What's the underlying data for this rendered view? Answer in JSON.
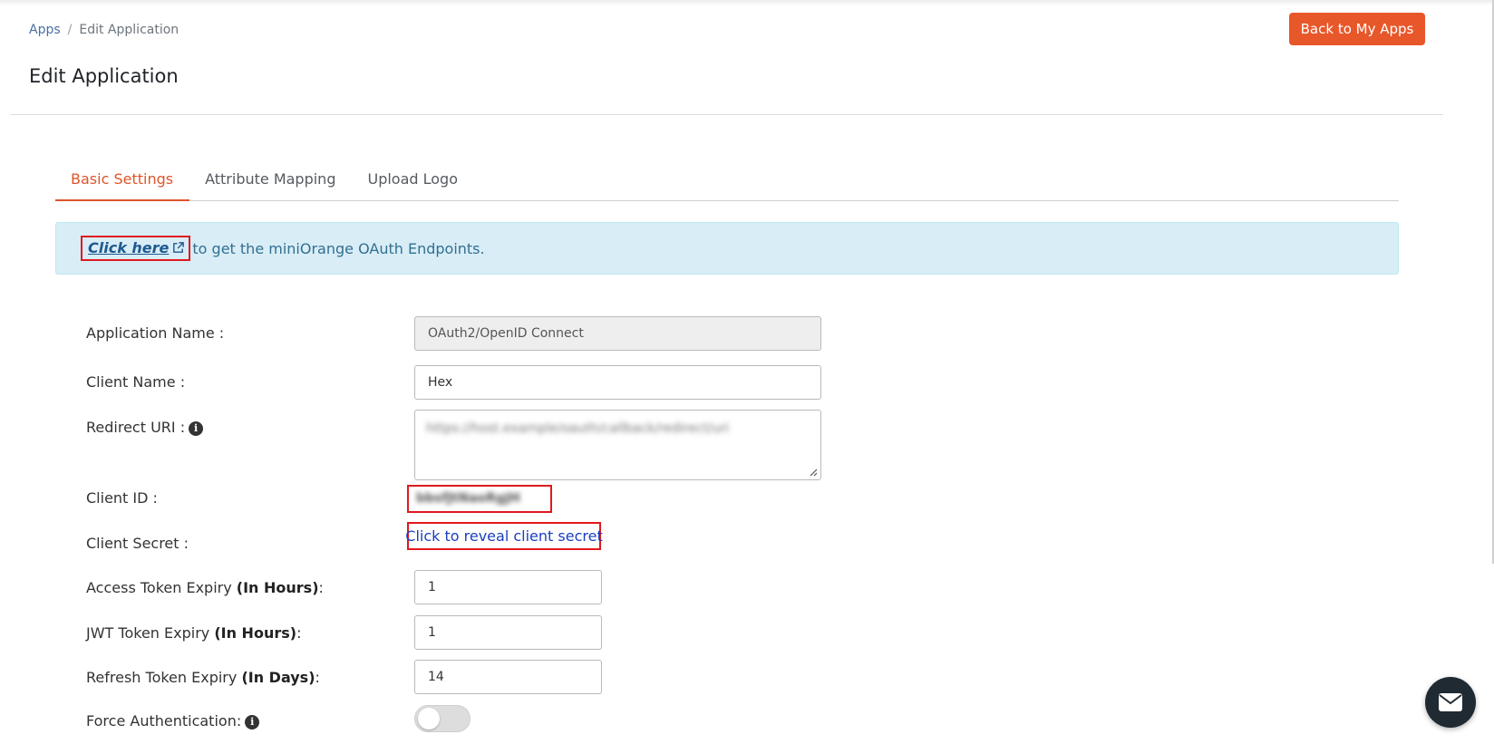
{
  "breadcrumb": {
    "root": "Apps",
    "separator": "/",
    "current": "Edit Application"
  },
  "page_title": "Edit Application",
  "header": {
    "back_button": "Back to My Apps"
  },
  "tabs": [
    {
      "label": "Basic Settings",
      "active": true
    },
    {
      "label": "Attribute Mapping",
      "active": false
    },
    {
      "label": "Upload Logo",
      "active": false
    }
  ],
  "alert": {
    "link_text": "Click here",
    "text": "to get the miniOrange OAuth Endpoints.",
    "icon": "external-link-icon"
  },
  "form": {
    "app_name": {
      "label": "Application Name :",
      "value": "OAuth2/OpenID Connect"
    },
    "client_name": {
      "label": "Client Name :",
      "value": "Hex"
    },
    "redirect_uri": {
      "label": "Redirect URI :",
      "value": "https://host.example/oauth/callback/redirect/uri"
    },
    "client_id": {
      "label": "Client ID :",
      "value": "bbsfJtNaoRgJH"
    },
    "client_secret": {
      "label": "Client Secret :",
      "link": "Click to reveal client secret"
    },
    "access_token": {
      "label": "Access Token Expiry ",
      "bold": "(In Hours)",
      "suffix": ":",
      "value": "1"
    },
    "jwt_token": {
      "label": "JWT Token Expiry ",
      "bold": "(In Hours)",
      "suffix": ":",
      "value": "1"
    },
    "refresh_token": {
      "label": "Refresh Token Expiry ",
      "bold": "(In Days)",
      "suffix": ":",
      "value": "14"
    },
    "force_auth": {
      "label": "Force Authentication:",
      "enabled": false
    }
  },
  "colors": {
    "accent": "#e8572a",
    "highlight": "#e0191e",
    "alert_bg": "#d9edf7",
    "link": "#1a3fbf"
  },
  "icons": {
    "info": "info-icon",
    "chat": "mail-icon"
  }
}
